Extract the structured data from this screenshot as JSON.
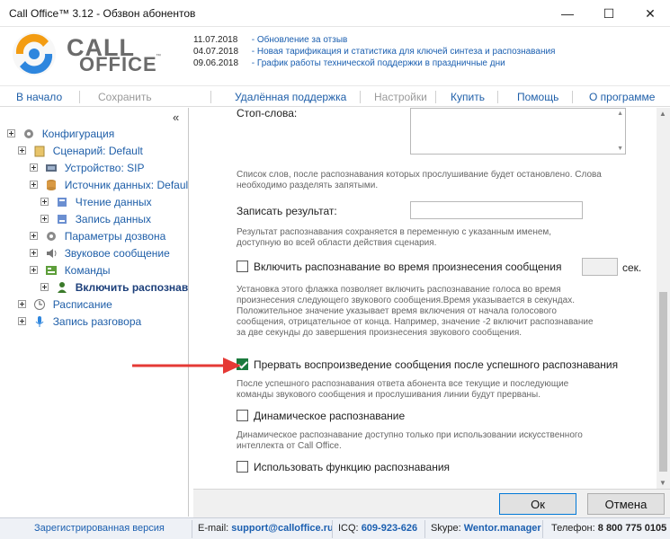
{
  "window": {
    "title": "Call Office™ 3.12 - Обзвон абонентов",
    "minimize": "—",
    "maximize": "☐",
    "close": "✕"
  },
  "logo": {
    "line1": "CALL",
    "line2": "OFFICE",
    "tm": "™"
  },
  "news": [
    {
      "date": "11.07.2018",
      "text": "- Обновление за отзыв"
    },
    {
      "date": "04.07.2018",
      "text": "- Новая тарификация и статистика для ключей синтеза и распознавания"
    },
    {
      "date": "09.06.2018",
      "text": "- График работы технической поддержки в праздничные дни"
    }
  ],
  "menu": {
    "home": "В начало",
    "save": "Сохранить",
    "remote": "Удалённая поддержка",
    "settings": "Настройки",
    "buy": "Купить",
    "help": "Помощь",
    "about": "О программе"
  },
  "tree": {
    "collapse": "«",
    "items": [
      {
        "label": "Конфигурация",
        "icon": "gear-icon"
      },
      {
        "label": "Сценарий: Default",
        "icon": "scenario-icon"
      },
      {
        "label": "Устройство: SIP",
        "icon": "device-icon"
      },
      {
        "label": "Источник данных: Default",
        "icon": "database-icon"
      },
      {
        "label": "Чтение данных",
        "icon": "read-icon"
      },
      {
        "label": "Запись данных",
        "icon": "write-icon"
      },
      {
        "label": "Параметры дозвона",
        "icon": "gear-icon"
      },
      {
        "label": "Звуковое сообщение",
        "icon": "speaker-icon"
      },
      {
        "label": "Команды",
        "icon": "commands-icon"
      },
      {
        "label": "Включить распознава",
        "icon": "person-icon"
      },
      {
        "label": "Расписание",
        "icon": "clock-icon"
      },
      {
        "label": "Запись разговора",
        "icon": "microphone-icon"
      }
    ]
  },
  "form": {
    "stopwords_label": "Стоп-слова:",
    "stopwords_desc": "Список слов, после распознавания которых прослушивание будет остановлено. Слова необходимо разделять запятыми.",
    "save_result_label": "Записать результат:",
    "save_result_value": "",
    "save_result_desc": "Результат распознавания сохраняется в переменную с указанным именем, доступную во всей области действия сценария.",
    "enable_during_label": "Включить распознавание во время произнесения сообщения",
    "enable_during_checked": false,
    "enable_during_seconds": "",
    "seconds_unit": "сек.",
    "enable_during_desc": "Установка этого флажка позволяет включить распознавание голоса во время произнесения следующего звукового сообщения.Время указывается в секундах. Положительное значение указывает время включения от начала голосового сообщения, отрицательное от конца. Например, значение -2 включит распознавание за две секунды до завершения произнесения звукового сообщения.",
    "interrupt_label": "Прервать воспроизведение сообщения после успешного распознавания",
    "interrupt_checked": true,
    "interrupt_desc": "После успешного распознавания ответа абонента все текущие и последующие команды звукового сообщения и прослушивания линии будут прерваны.",
    "dynamic_label": "Динамическое распознавание",
    "dynamic_checked": false,
    "dynamic_desc": "Динамическое распознавание доступно только при использовании искусственного интеллекта от Call Office.",
    "use_function_label": "Использовать функцию распознавания",
    "use_function_checked": false
  },
  "buttons": {
    "ok": "Ок",
    "cancel": "Отмена"
  },
  "status": {
    "registered": "Зарегистрированная версия",
    "email_label": "E-mail:",
    "email": "support@calloffice.ru",
    "icq_label": "ICQ:",
    "icq": "609-923-626",
    "skype_label": "Skype:",
    "skype": "Wentor.manager",
    "phone_label": "Телефон:",
    "phone": "8 800 775 0105"
  },
  "colors": {
    "accent": "#1b5fb0",
    "checkbox": "#1a7a3d",
    "arrow": "#e53935"
  }
}
